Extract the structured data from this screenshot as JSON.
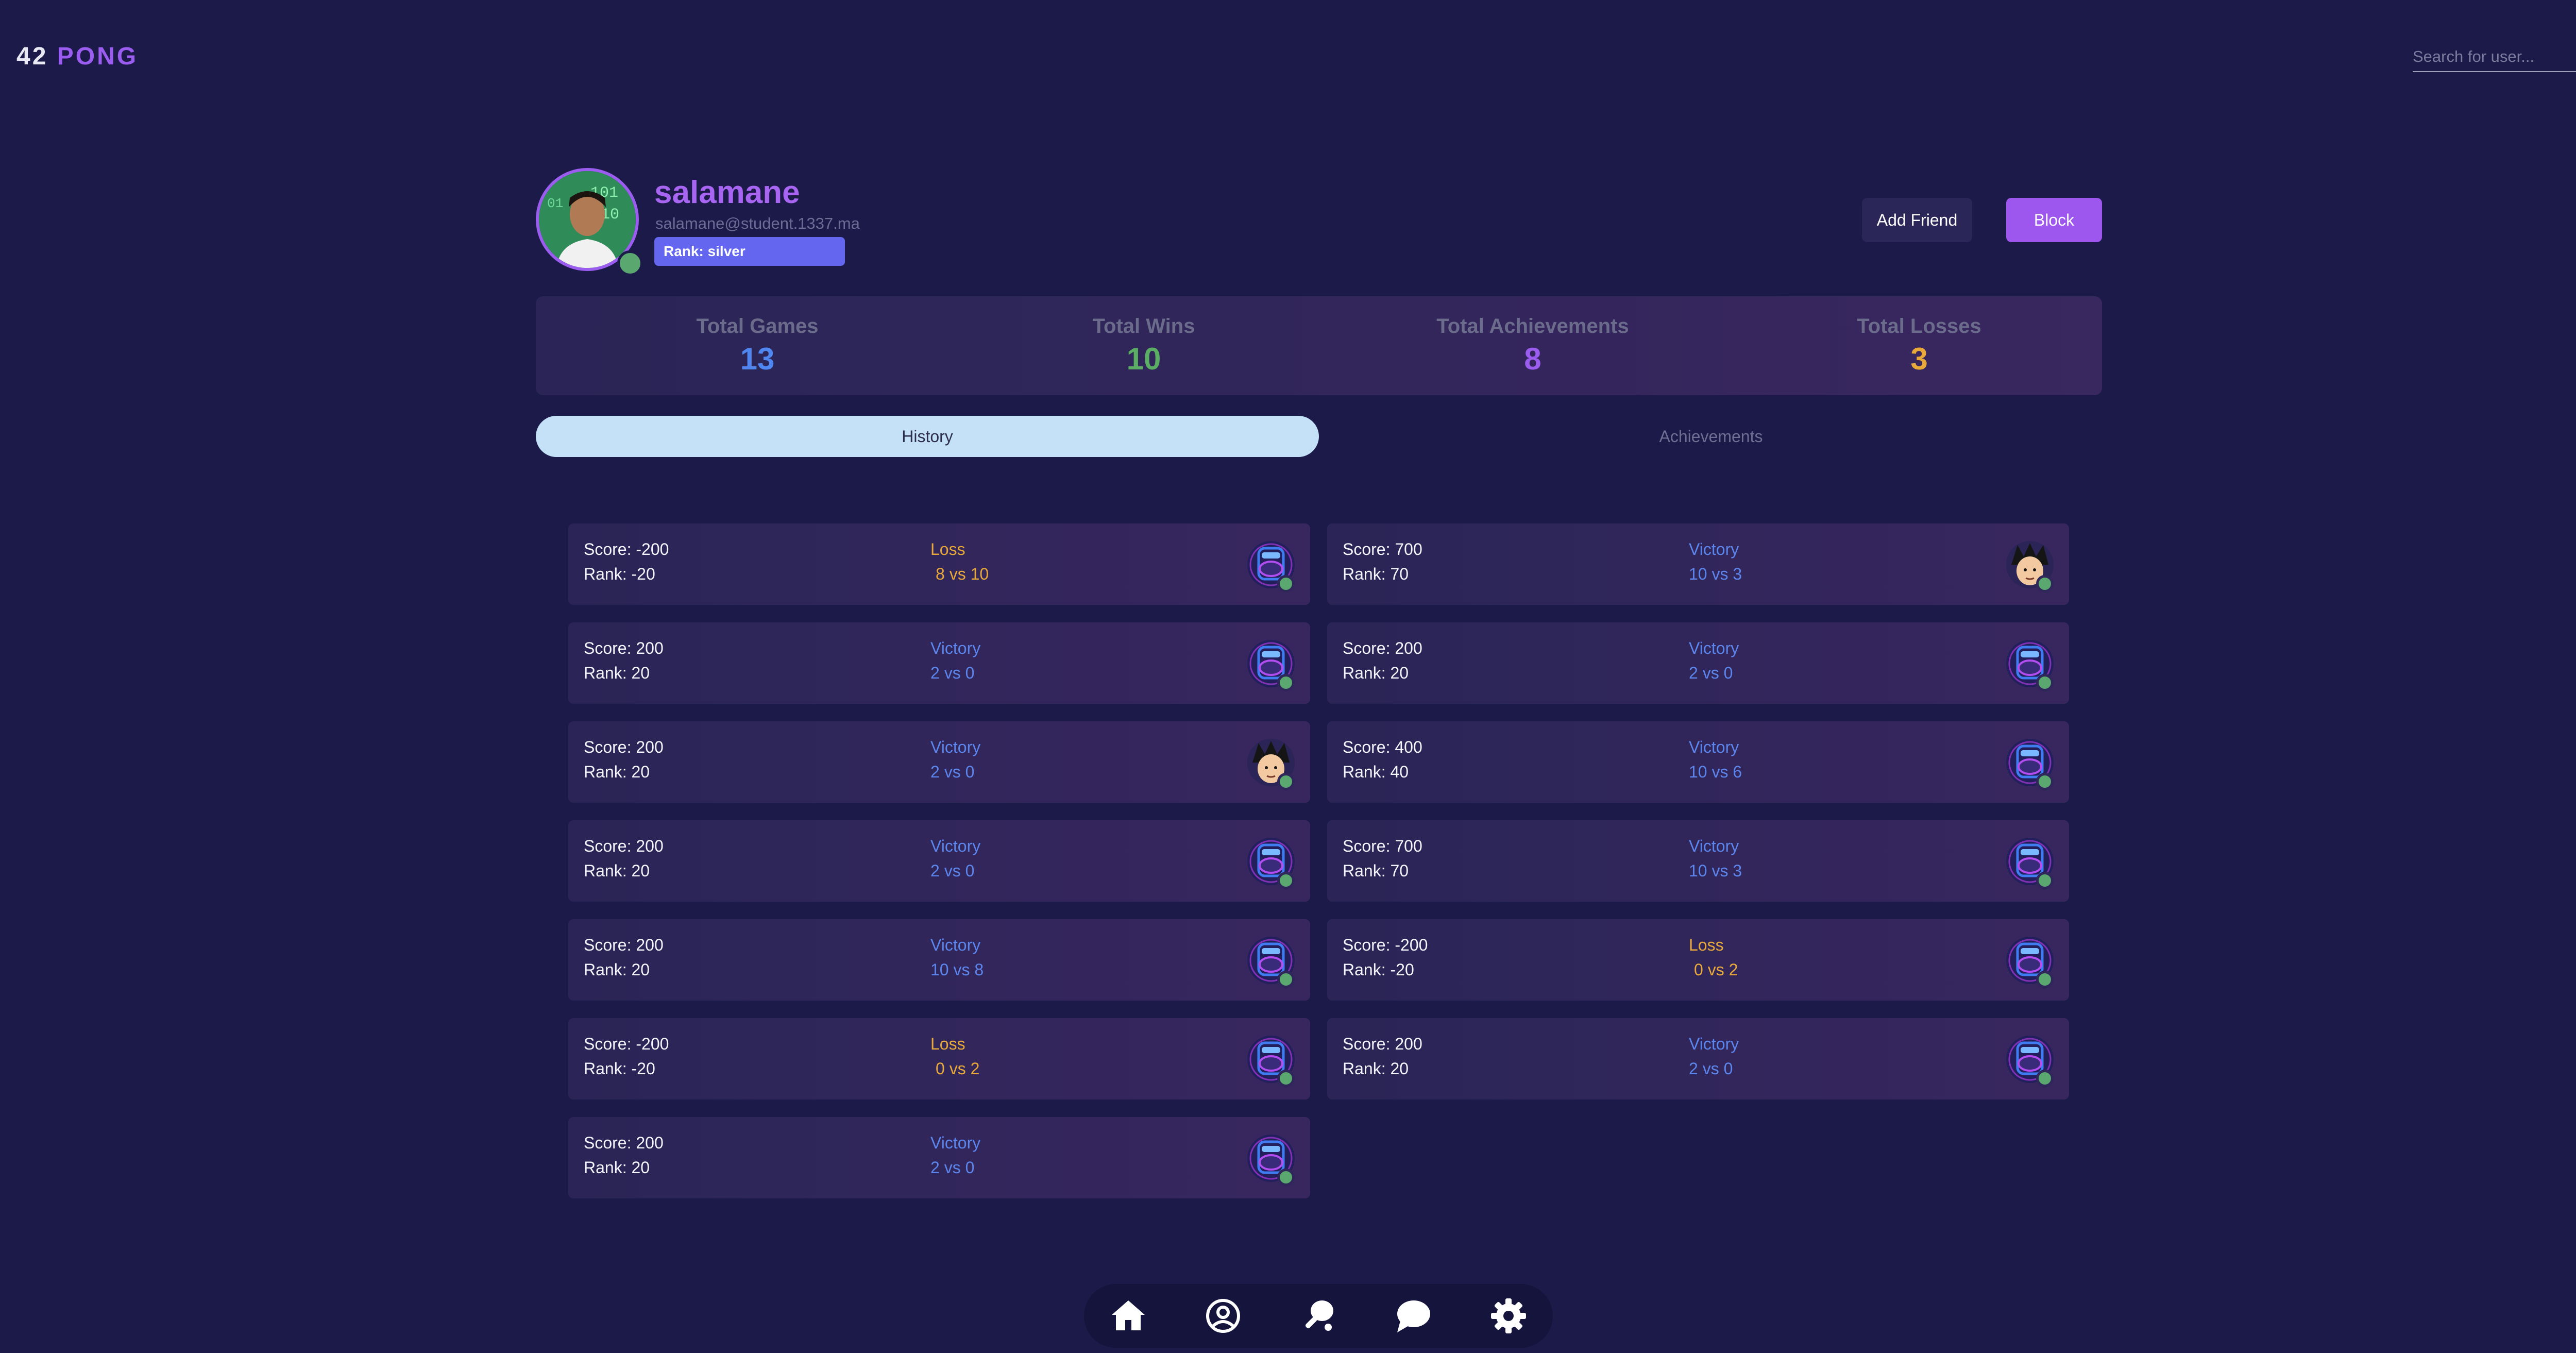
{
  "header": {
    "logo_num": "42",
    "logo_word": "PONG",
    "search_placeholder": "Search for user..."
  },
  "profile": {
    "username": "salamane",
    "email": "salamane@student.1337.ma",
    "rank": "Rank: silver",
    "online": true,
    "add_friend_label": "Add Friend",
    "block_label": "Block"
  },
  "stats": [
    {
      "label": "Total Games",
      "value": "13",
      "color": "#4f86f0"
    },
    {
      "label": "Total Wins",
      "value": "10",
      "color": "#5aad63"
    },
    {
      "label": "Total Achievements",
      "value": "8",
      "color": "#9b5cf0"
    },
    {
      "label": "Total Losses",
      "value": "3",
      "color": "#e9a93a"
    }
  ],
  "tabs": {
    "history": "History",
    "achievements": "Achievements",
    "active": "history"
  },
  "colors": {
    "victory": "#5c86ee",
    "loss": "#e9a93a",
    "accent": "#9b5cf0",
    "online": "#5aa86f"
  },
  "history_left": [
    {
      "score": "Score: -200",
      "rank": "Rank: -20",
      "result": "Loss",
      "vs": "8 vs 10",
      "avatar": "gamepad"
    },
    {
      "score": "Score: 200",
      "rank": "Rank: 20",
      "result": "Victory",
      "vs": "2 vs 0",
      "avatar": "gamepad"
    },
    {
      "score": "Score: 200",
      "rank": "Rank: 20",
      "result": "Victory",
      "vs": "2 vs 0",
      "avatar": "goku"
    },
    {
      "score": "Score: 200",
      "rank": "Rank: 20",
      "result": "Victory",
      "vs": "2 vs 0",
      "avatar": "gamepad"
    },
    {
      "score": "Score: 200",
      "rank": "Rank: 20",
      "result": "Victory",
      "vs": "10 vs 8",
      "avatar": "gamepad"
    },
    {
      "score": "Score: -200",
      "rank": "Rank: -20",
      "result": "Loss",
      "vs": "0 vs 2",
      "avatar": "gamepad"
    },
    {
      "score": "Score: 200",
      "rank": "Rank: 20",
      "result": "Victory",
      "vs": "2 vs 0",
      "avatar": "gamepad"
    }
  ],
  "history_right": [
    {
      "score": "Score: 700",
      "rank": "Rank: 70",
      "result": "Victory",
      "vs": "10 vs 3",
      "avatar": "goku"
    },
    {
      "score": "Score: 200",
      "rank": "Rank: 20",
      "result": "Victory",
      "vs": "2 vs 0",
      "avatar": "gamepad"
    },
    {
      "score": "Score: 400",
      "rank": "Rank: 40",
      "result": "Victory",
      "vs": "10 vs 6",
      "avatar": "gamepad"
    },
    {
      "score": "Score: 700",
      "rank": "Rank: 70",
      "result": "Victory",
      "vs": "10 vs 3",
      "avatar": "gamepad"
    },
    {
      "score": "Score: -200",
      "rank": "Rank: -20",
      "result": "Loss",
      "vs": "0 vs 2",
      "avatar": "gamepad"
    },
    {
      "score": "Score: 200",
      "rank": "Rank: 20",
      "result": "Victory",
      "vs": "2 vs 0",
      "avatar": "gamepad"
    }
  ],
  "dock": [
    "home-icon",
    "profile-icon",
    "ping-pong-icon",
    "chat-icon",
    "settings-icon"
  ]
}
